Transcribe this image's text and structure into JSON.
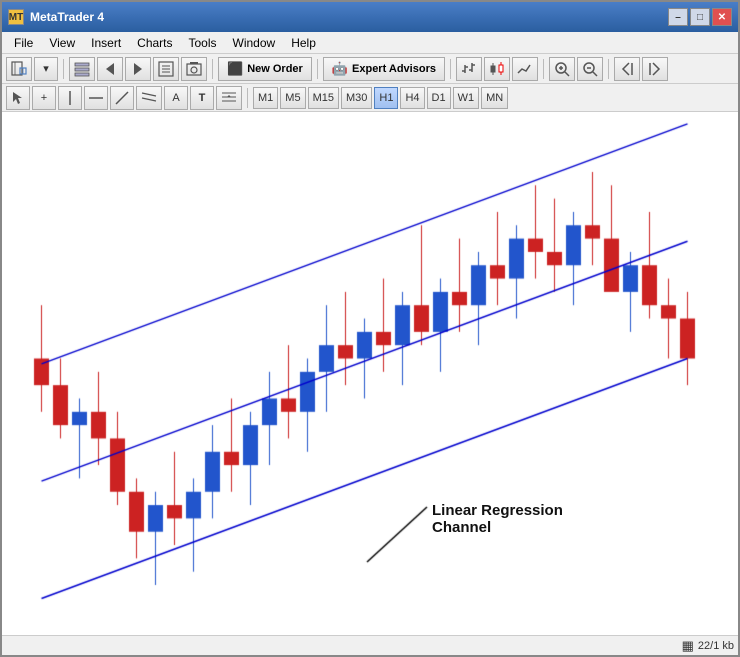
{
  "window": {
    "title": "MetaTrader 4",
    "icon": "MT"
  },
  "title_controls": {
    "minimize": "–",
    "maximize": "□",
    "close": "✕"
  },
  "menu": {
    "items": [
      "File",
      "View",
      "Insert",
      "Charts",
      "Tools",
      "Window",
      "Help"
    ]
  },
  "toolbar1": {
    "new_order_label": "New Order",
    "expert_advisors_label": "Expert Advisors"
  },
  "toolbar2": {
    "timeframes": [
      "M1",
      "M5",
      "M15",
      "M30",
      "H1",
      "H4",
      "D1",
      "W1",
      "MN"
    ],
    "active_timeframe": "H1"
  },
  "chart": {
    "annotation_label": "Linear Regression\nChannel",
    "line_color": "#0000cd"
  },
  "status_bar": {
    "grid_icon": "▦",
    "info": "22/1 kb"
  }
}
